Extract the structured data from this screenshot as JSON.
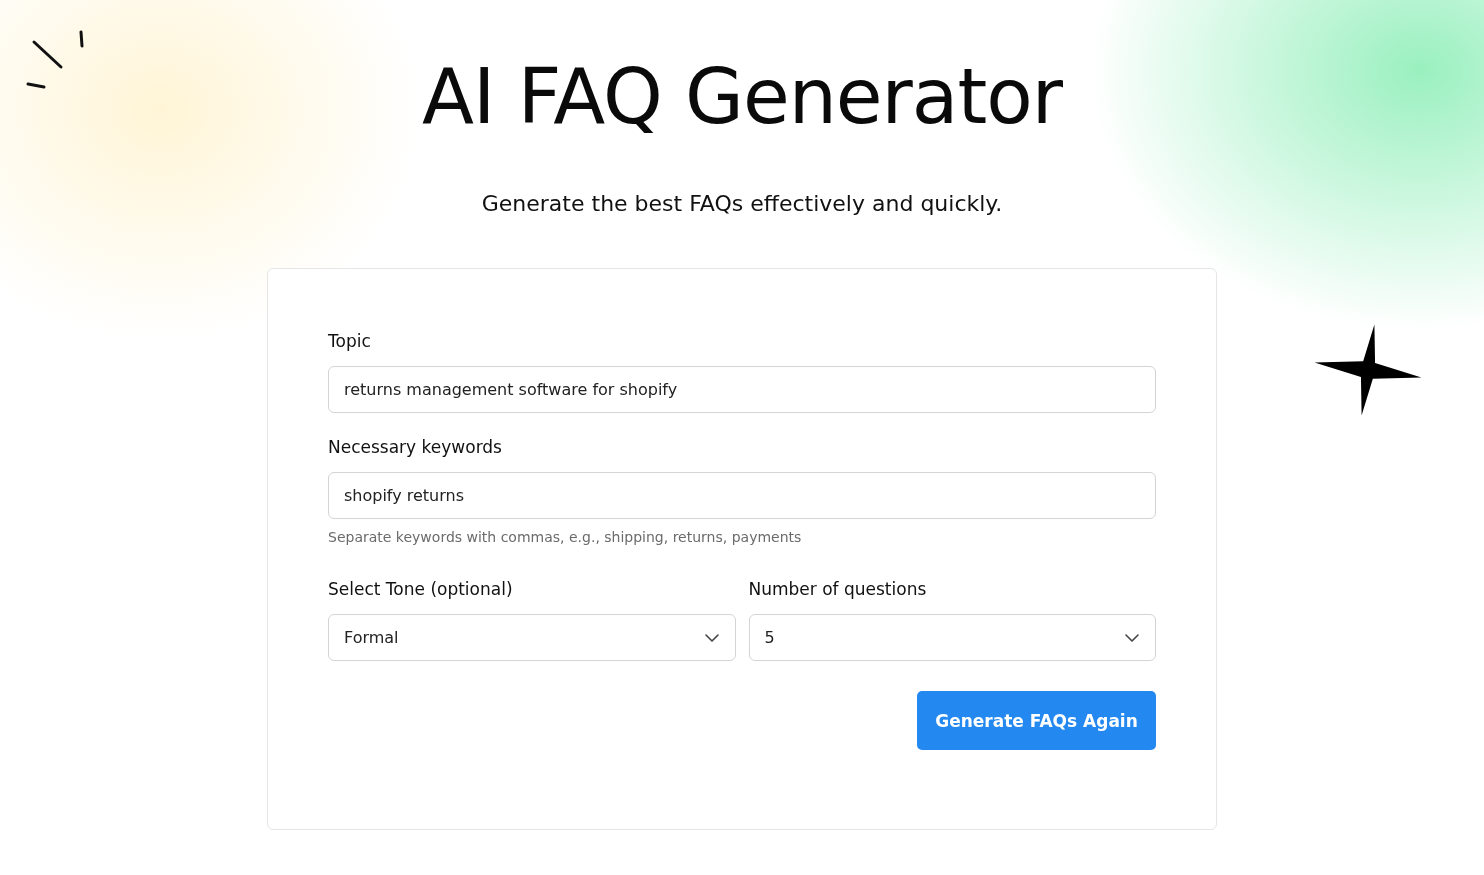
{
  "title": "AI FAQ Generator",
  "subtitle": "Generate the best FAQs effectively and quickly.",
  "form": {
    "fields": [
      {
        "kind": "text",
        "label": "Topic",
        "value": "returns management software for shopify"
      },
      {
        "kind": "text",
        "label": "Necessary keywords",
        "value": "shopify returns",
        "hint": "Separate keywords with commas, e.g., shipping, returns, payments"
      }
    ],
    "selects": [
      {
        "label": "Select Tone (optional)",
        "value": "Formal"
      },
      {
        "label": "Number of questions",
        "value": "5"
      }
    ],
    "button": "Generate FAQs Again"
  }
}
